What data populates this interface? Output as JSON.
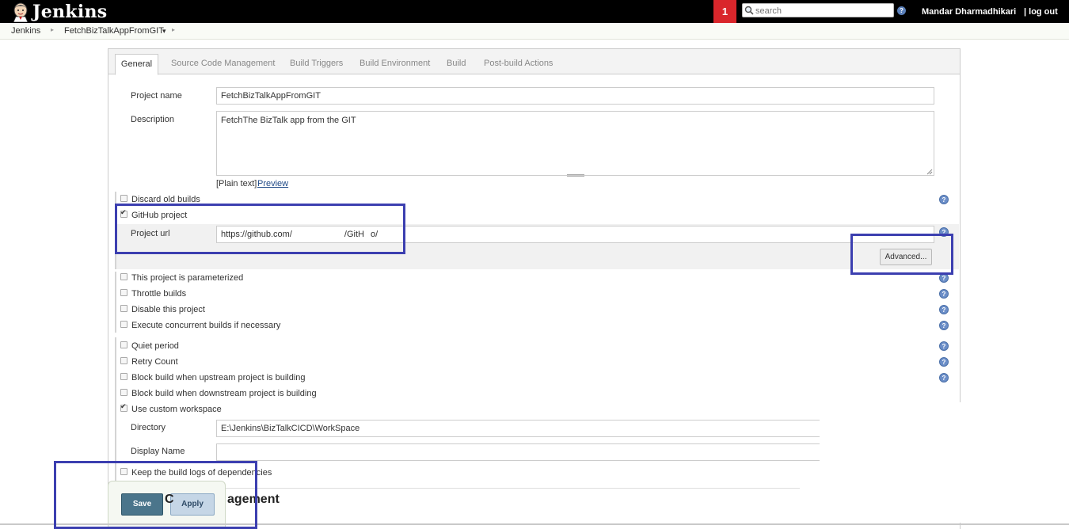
{
  "header": {
    "brand": "Jenkins",
    "notification_count": "1",
    "search_placeholder": "search",
    "help_glyph": "?",
    "user": "Mandar Dharmadhikari",
    "logout": "| log out"
  },
  "breadcrumb": {
    "items": [
      "Jenkins",
      "FetchBizTalkAppFromGIT"
    ],
    "dropdown_glyph": "▾",
    "separator": "▸"
  },
  "tabs": [
    "General",
    "Source Code Management",
    "Build Triggers",
    "Build Environment",
    "Build",
    "Post-build Actions"
  ],
  "form": {
    "project_name_label": "Project name",
    "project_name_value": "FetchBizTalkAppFromGIT",
    "description_label": "Description",
    "description_value": "FetchThe BizTalk app from the GIT",
    "plain_text": "[Plain text]",
    "preview": "Preview",
    "discard_old_builds": "Discard old builds",
    "github_project": "GitHub project",
    "project_url_label": "Project url",
    "project_url_prefix": "https://github.com/",
    "project_url_suffix_1": "/GitH",
    "project_url_suffix_2": "o/",
    "advanced": "Advanced...",
    "options_1": [
      {
        "label": "This project is parameterized",
        "checked": false
      },
      {
        "label": "Throttle builds",
        "checked": false
      },
      {
        "label": "Disable this project",
        "checked": false
      },
      {
        "label": "Execute concurrent builds if necessary",
        "checked": false
      }
    ],
    "options_2": [
      {
        "label": "Quiet period",
        "checked": false
      },
      {
        "label": "Retry Count",
        "checked": false
      },
      {
        "label": "Block build when upstream project is building",
        "checked": false
      },
      {
        "label": "Block build when downstream project is building",
        "checked": false
      },
      {
        "label": "Use custom workspace",
        "checked": true
      }
    ],
    "directory_label": "Directory",
    "directory_value": "E:\\Jenkins\\BizTalkCICD\\WorkSpace",
    "display_name_label": "Display Name",
    "display_name_value": "",
    "keep_logs": "Keep the build logs of dependencies"
  },
  "footer": {
    "save": "Save",
    "apply": "Apply",
    "next_section_title_partial": "agement",
    "next_section_title_initial": "C"
  },
  "colors": {
    "header_bg": "#000000",
    "notification_bg": "#d9262b",
    "annotation_box": "#3c3fb0",
    "save_button": "#4b758b"
  }
}
